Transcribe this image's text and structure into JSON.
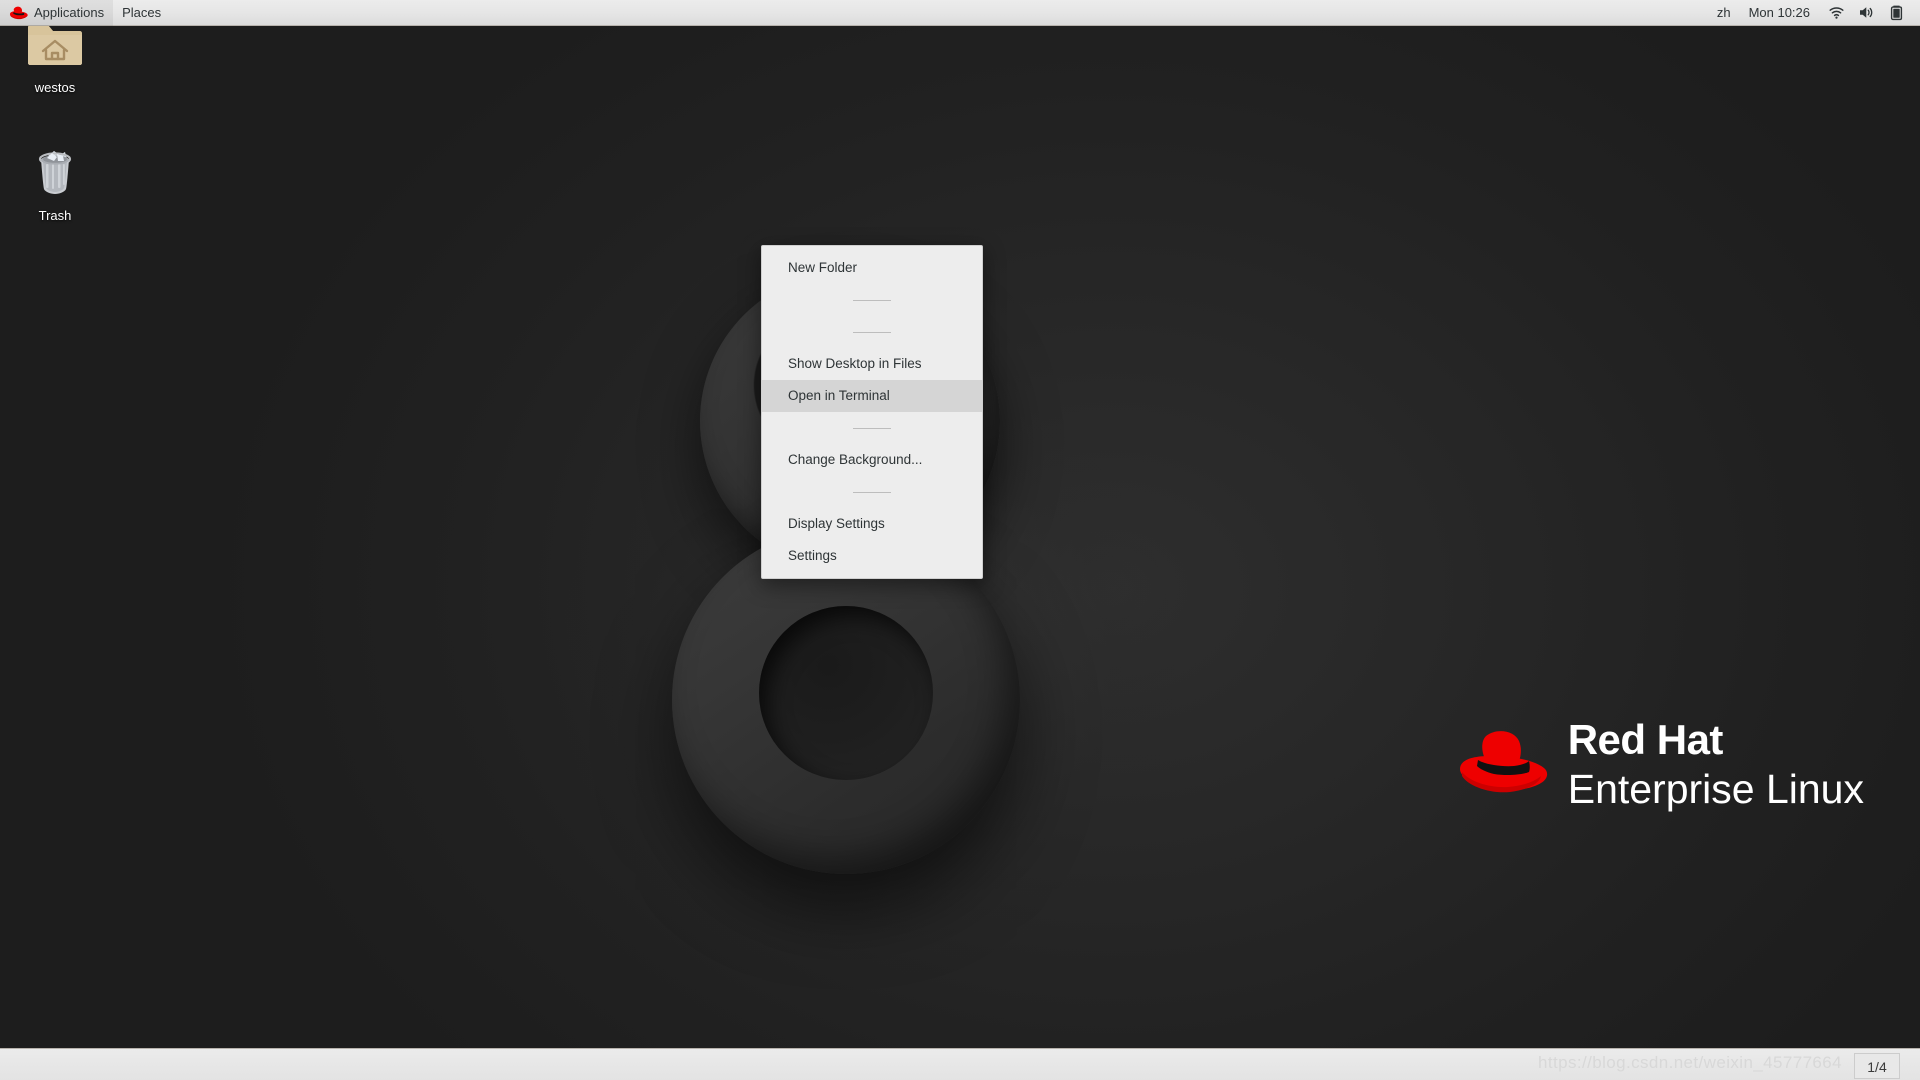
{
  "panel": {
    "logo_icon": "redhat-logo-icon",
    "applications_label": "Applications",
    "places_label": "Places",
    "input_source": "zh",
    "clock": "Mon 10:26",
    "icons": [
      "wifi-icon",
      "volume-icon",
      "battery-icon"
    ]
  },
  "desktop": {
    "icons": [
      {
        "name": "westos",
        "label": "westos",
        "icon": "home-folder-icon"
      },
      {
        "name": "trash",
        "label": "Trash",
        "icon": "trash-icon"
      }
    ],
    "wallpaper": "rhel8-rings",
    "background_color": "#202020"
  },
  "context_menu": {
    "items": [
      {
        "label": "New Folder",
        "type": "item",
        "selected": false
      },
      {
        "label": "",
        "type": "separator"
      },
      {
        "label": "",
        "type": "separator"
      },
      {
        "label": "Show Desktop in Files",
        "type": "item",
        "selected": false
      },
      {
        "label": "Open in Terminal",
        "type": "item",
        "selected": true
      },
      {
        "label": "",
        "type": "separator"
      },
      {
        "label": "Change Background...",
        "type": "item",
        "selected": false
      },
      {
        "label": "",
        "type": "separator"
      },
      {
        "label": "Display Settings",
        "type": "item",
        "selected": false
      },
      {
        "label": "Settings",
        "type": "item",
        "selected": false
      }
    ],
    "highlight_color": "#d5d5d5",
    "background_color": "#ededed"
  },
  "branding": {
    "line1": "Red Hat",
    "line2": "Enterprise Linux",
    "hat_color": "#ee0000",
    "text_color": "#ffffff"
  },
  "footer": {
    "watermark": "https://blog.csdn.net/weixin_45777664",
    "page_indicator": "1/4"
  }
}
